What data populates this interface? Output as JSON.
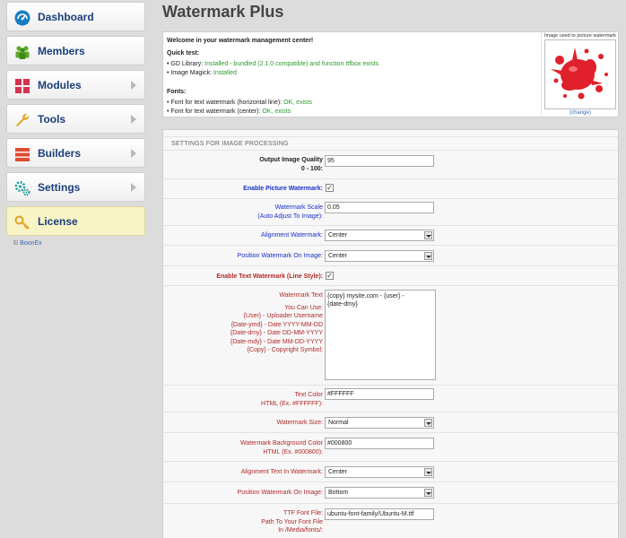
{
  "sidebar": {
    "items": [
      {
        "label": "Dashboard",
        "icon": "dashboard-icon",
        "color": "#1a7dc4"
      },
      {
        "label": "Members",
        "icon": "members-icon",
        "color": "#5aab2a"
      },
      {
        "label": "Modules",
        "icon": "modules-icon",
        "color": "#d6314f"
      },
      {
        "label": "Tools",
        "icon": "wrench-icon",
        "color": "#e0a321"
      },
      {
        "label": "Builders",
        "icon": "builders-icon",
        "color": "#e04b2f"
      },
      {
        "label": "Settings",
        "icon": "gears-icon",
        "color": "#1d9a9a"
      },
      {
        "label": "License",
        "icon": "key-icon",
        "color": "#e0a321"
      }
    ],
    "copyright_prefix": "©",
    "copyright_link": "BoonEx"
  },
  "page": {
    "title": "Watermark Plus"
  },
  "info": {
    "welcome": "Welcome in your watermark management center!",
    "quick_test_heading": "Quick test:",
    "gd_label": "GD Library: ",
    "gd_value": "Installed - bundled (2.1.0 compatible) and function ttfbox exists",
    "magick_label": "Image Magick: ",
    "magick_value": "Installed",
    "fonts_heading": "Fonts:",
    "font_horizontal_label": "Font for text watermark (horizontal line): ",
    "font_horizontal_value": "OK, exists",
    "font_center_label": "Font for text watermark (center): ",
    "font_center_value": "OK, exists",
    "preview_caption": "Image used to picture watermark",
    "preview_change": "(change)"
  },
  "settings": {
    "heading": "SETTINGS FOR IMAGE PROCESSING",
    "quality_label": "Output Image Quality",
    "quality_sub": "0 - 100:",
    "quality_value": "95",
    "enable_picture_label": "Enable Picture Watermark:",
    "enable_picture_checked": "✓",
    "scale_label": "Watermark Scale",
    "scale_sub": "(Auto Adjust To Image):",
    "scale_value": "0.05",
    "alignment_label": "Alignment Watermark:",
    "alignment_value": "Center",
    "position_label": "Position Watermark On Image:",
    "position_value": "Center",
    "enable_text_label": "Enable Text Watermark (Line Style):",
    "enable_text_checked": "✓",
    "text_label": "Watermark Text",
    "text_help": [
      "You Can Use:",
      "{User} - Uploader Username",
      "{Date-ymd} - Date YYYY-MM-DD",
      "{Date-dmy} - Date DD-MM-YYYY",
      "{Date-mdy} - Date MM-DD-YYYY",
      "{Copy} - Copyright Symbol:"
    ],
    "text_value_line1": "{copy} mysite.com - {user} -",
    "text_value_line2": "{date-dmy}",
    "text_color_label": "Text Color",
    "text_color_sub": "HTML (Ex. #FFFFFF):",
    "text_color_value": "#FFFFFF",
    "size_label": "Watermark Size:",
    "size_value": "Normal",
    "bg_color_label": "Watermark Background Color",
    "bg_color_sub": "HTML (Ex. #000800):",
    "bg_color_value": "#000800",
    "align_text_label": "Alignment Text In Watermark:",
    "align_text_value": "Center",
    "position_text_label": "Position Watermark On Image:",
    "position_text_value": "Bottom",
    "ttf_label": "TTF Font File:",
    "ttf_sub1": "Path To Your Font File",
    "ttf_sub2": "In /Media/fonts/:",
    "ttf_value": "ubuntu-font-family/Ubuntu-M.ttf"
  }
}
